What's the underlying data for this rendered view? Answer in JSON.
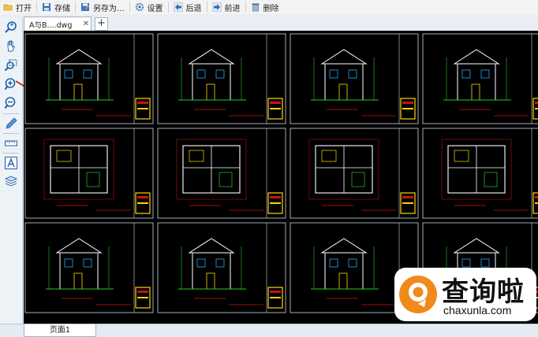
{
  "toolbar": {
    "open_label": "打开",
    "save_label": "存储",
    "saveas_label": "另存为...",
    "settings_label": "设置",
    "back_label": "后退",
    "forward_label": "前进",
    "delete_label": "删除"
  },
  "tabs": {
    "document_tab": "A与B....dwg",
    "add_tab": "+"
  },
  "status": {
    "page_tab": "页面1"
  },
  "watermark": {
    "title": "查询啦",
    "url": "chaxunla.com"
  },
  "colors": {
    "canvas_bg": "#000000",
    "drawing_frame": "#cfd6dc",
    "titleblock_red": "#cc1111",
    "titleblock_yellow": "#ffd400",
    "accent_blue": "#2b6cb0",
    "watermark_orange": "#f08a1a"
  }
}
